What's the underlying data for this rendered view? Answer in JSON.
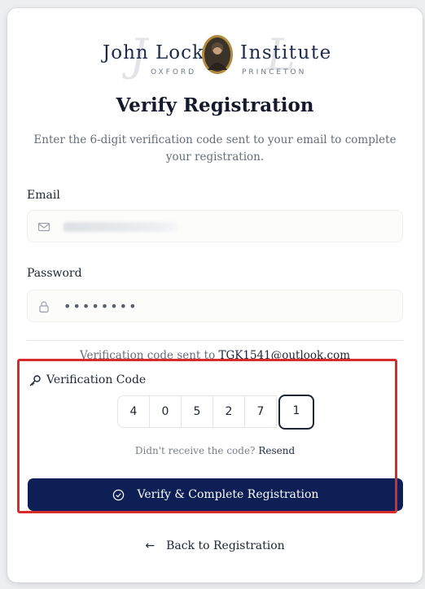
{
  "logo": {
    "left_text": "John Locke",
    "right_text": "Institute",
    "left_sub": "OXFORD",
    "right_sub": "PRINCETON"
  },
  "page": {
    "title": "Verify Registration",
    "subtitle": "Enter the 6-digit verification code sent to your email to complete your registration."
  },
  "form": {
    "email_label": "Email",
    "email_icon": "mail-icon",
    "password_label": "Password",
    "password_value": "••••••••",
    "password_icon": "lock-icon"
  },
  "verification": {
    "sent_prefix": "Verification code sent to",
    "sent_email": "TGK1541@outlook.com",
    "label": "Verification Code",
    "label_icon": "key-icon",
    "digits": [
      "4",
      "0",
      "5",
      "2",
      "7",
      "1"
    ],
    "resend_prompt": "Didn't receive the code?",
    "resend_link": "Resend"
  },
  "actions": {
    "verify_label": "Verify & Complete Registration",
    "verify_icon": "check-circle-icon",
    "back_label": "Back to Registration",
    "back_icon": "arrow-left-icon"
  },
  "colors": {
    "primary": "#0d1f55",
    "highlight": "#d92b2b"
  }
}
